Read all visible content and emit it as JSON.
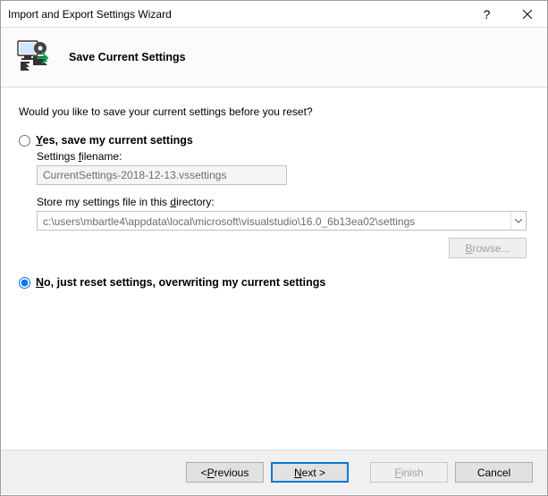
{
  "window": {
    "title": "Import and Export Settings Wizard"
  },
  "header": {
    "title": "Save Current Settings"
  },
  "content": {
    "prompt": "Would you like to save your current settings before you reset?",
    "option_yes": {
      "prefix": "Y",
      "rest": "es, save my current settings"
    },
    "filename_label_prefix": "Settings ",
    "filename_label_key": "f",
    "filename_label_suffix": "ilename:",
    "filename_value": "CurrentSettings-2018-12-13.vssettings",
    "directory_label_prefix": "Store my settings file in this ",
    "directory_label_key": "d",
    "directory_label_suffix": "irectory:",
    "directory_value": "c:\\users\\mbartle4\\appdata\\local\\microsoft\\visualstudio\\16.0_6b13ea02\\settings",
    "browse_label": "Browse...",
    "option_no": {
      "prefix": "N",
      "rest": "o, just reset settings, overwriting my current settings"
    }
  },
  "footer": {
    "previous_prefix": "< ",
    "previous_key": "P",
    "previous_suffix": "revious",
    "next_key": "N",
    "next_suffix": "ext >",
    "finish_key": "F",
    "finish_suffix": "inish",
    "cancel": "Cancel"
  }
}
